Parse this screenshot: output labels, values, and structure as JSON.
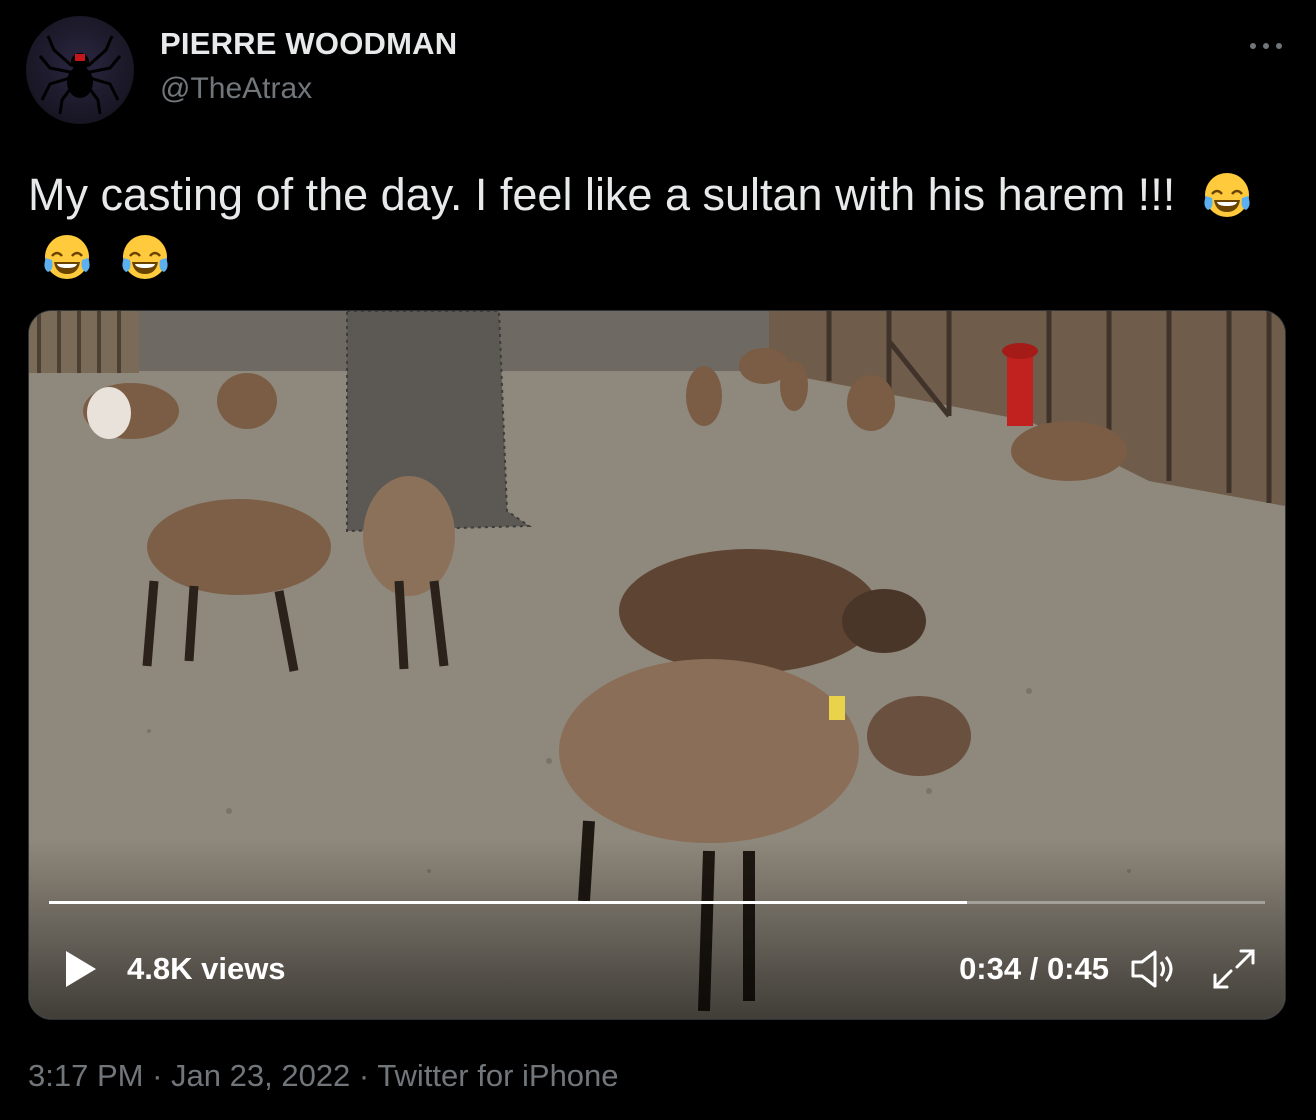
{
  "author": {
    "display_name": "PIERRE WOODMAN",
    "handle": "@TheAtrax"
  },
  "tweet": {
    "text": "My casting of the day. I feel like a sultan with his harem !!!",
    "emojis": [
      "face-with-tears-of-joy",
      "face-with-tears-of-joy",
      "face-with-tears-of-joy"
    ]
  },
  "video": {
    "views": "4.8K views",
    "time": "0:34 / 0:45",
    "progress": 0.755
  },
  "meta": {
    "time": "3:17 PM",
    "date": "Jan 23, 2022",
    "source": "Twitter for iPhone",
    "separator": "·"
  },
  "colors": {
    "background": "#000000",
    "text": "#e7e9ea",
    "muted": "#71767b"
  }
}
